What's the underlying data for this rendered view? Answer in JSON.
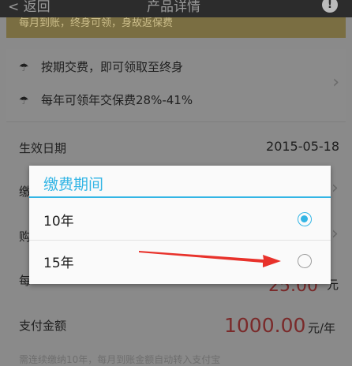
{
  "topbar": {
    "back_label": "返回",
    "title": "产品详情",
    "info_icon": "info-icon"
  },
  "banner": {
    "text": "每月到账，终身可领，身故返保费"
  },
  "benefits": [
    {
      "icon": "umbrella-icon",
      "text": "按期交费，即可领取至终身"
    },
    {
      "icon": "umbrella-icon",
      "text": "每年可领年交保费28%-41%"
    }
  ],
  "rows": {
    "effective_date": {
      "label": "生效日期",
      "value": "2015-05-18"
    },
    "payment_period_label_partial": "缴",
    "purchase_label_partial": "购",
    "monthly_label_partial": "每",
    "monthly_value_partial": "25.00",
    "monthly_unit": "元",
    "payment_amount": {
      "label": "支付金额",
      "value": "1000.00",
      "unit": "元/年"
    }
  },
  "footnote": "需连续缴纳10年，每月到账金额自动转入支付宝",
  "dialog": {
    "title": "缴费期间",
    "options": [
      {
        "label": "10年",
        "selected": true
      },
      {
        "label": "15年",
        "selected": false
      }
    ]
  },
  "colors": {
    "accent": "#33b5e5",
    "amount": "#c0392b",
    "arrow": "#e8322b"
  }
}
